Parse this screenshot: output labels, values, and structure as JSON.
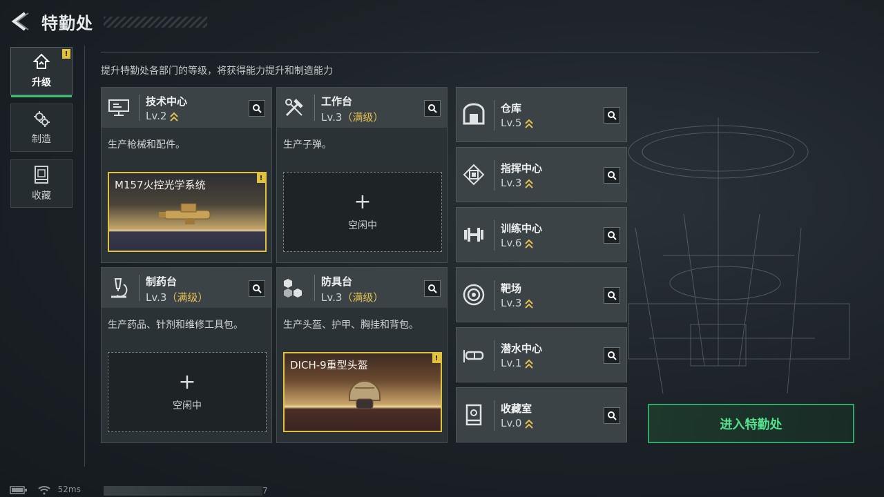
{
  "header": {
    "title": "特勤处"
  },
  "nav": [
    {
      "label": "升级",
      "active": true,
      "badge": "!"
    },
    {
      "label": "制造",
      "active": false
    },
    {
      "label": "收藏",
      "active": false
    }
  ],
  "subtitle": "提升特勤处各部门的等级，将获得能力提升和制造能力",
  "modules": [
    {
      "name": "技术中心",
      "level": "Lv.2",
      "max_tag": "",
      "desc": "生产枪械和配件。",
      "slot_item": "M157火控光学系统",
      "slot_badge": "!"
    },
    {
      "name": "工作台",
      "level": "Lv.3",
      "max_tag": "（满级）",
      "desc": "生产子弹。",
      "slot_idle": "空闲中"
    },
    {
      "name": "制药台",
      "level": "Lv.3",
      "max_tag": "（满级）",
      "desc": "生产药品、针剂和维修工具包。",
      "slot_idle": "空闲中"
    },
    {
      "name": "防具台",
      "level": "Lv.3",
      "max_tag": "（满级）",
      "desc": "生产头盔、护甲、胸挂和背包。",
      "slot_item": "DICH-9重型头盔",
      "slot_badge": "!"
    }
  ],
  "facilities": [
    {
      "name": "仓库",
      "level": "Lv.5",
      "icon": "vault-icon"
    },
    {
      "name": "指挥中心",
      "level": "Lv.3",
      "icon": "chip-icon"
    },
    {
      "name": "训练中心",
      "level": "Lv.6",
      "icon": "dumbbell-icon"
    },
    {
      "name": "靶场",
      "level": "Lv.3",
      "icon": "target-icon"
    },
    {
      "name": "潜水中心",
      "level": "Lv.1",
      "icon": "diving-mask-icon"
    },
    {
      "name": "收藏室",
      "level": "Lv.0",
      "icon": "display-case-icon"
    }
  ],
  "enter_button": "进入特勤处",
  "status": {
    "ping": "52ms",
    "load_suffix": "7"
  },
  "colors": {
    "accent_green": "#38c070",
    "gold": "#e6c150",
    "badge": "#e2c23c"
  }
}
